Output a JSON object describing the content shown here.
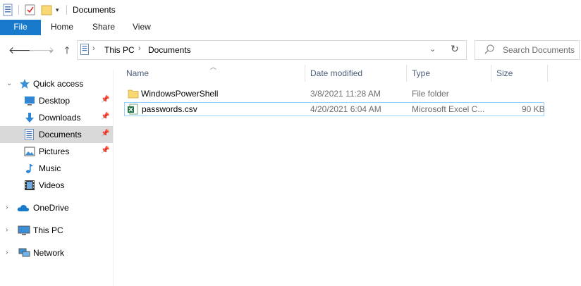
{
  "window": {
    "title": "Documents"
  },
  "ribbon": {
    "tabs": [
      {
        "label": "File"
      },
      {
        "label": "Home"
      },
      {
        "label": "Share"
      },
      {
        "label": "View"
      }
    ]
  },
  "address": {
    "crumbs": [
      {
        "label": "This PC"
      },
      {
        "label": "Documents"
      }
    ]
  },
  "search": {
    "placeholder": "Search Documents"
  },
  "nav": {
    "items": [
      {
        "label": "Quick access",
        "icon": "star-icon"
      },
      {
        "label": "Desktop",
        "icon": "desktop-icon",
        "pinned": true
      },
      {
        "label": "Downloads",
        "icon": "download-icon",
        "pinned": true
      },
      {
        "label": "Documents",
        "icon": "documents-icon",
        "pinned": true,
        "selected": true
      },
      {
        "label": "Pictures",
        "icon": "pictures-icon",
        "pinned": true
      },
      {
        "label": "Music",
        "icon": "music-icon"
      },
      {
        "label": "Videos",
        "icon": "videos-icon"
      },
      {
        "label": "OneDrive",
        "icon": "cloud-icon"
      },
      {
        "label": "This PC",
        "icon": "computer-icon"
      },
      {
        "label": "Network",
        "icon": "network-icon"
      }
    ]
  },
  "columns": {
    "name": "Name",
    "date": "Date modified",
    "type": "Type",
    "size": "Size"
  },
  "files": [
    {
      "name": "WindowsPowerShell",
      "date": "3/8/2021 11:28 AM",
      "type": "File folder",
      "size": "",
      "icon": "folder-icon"
    },
    {
      "name": "passwords.csv",
      "date": "4/20/2021 6:04 AM",
      "type": "Microsoft Excel C...",
      "size": "90 KB",
      "icon": "excel-icon",
      "selected": true
    }
  ],
  "colors": {
    "accent": "#1979ca",
    "selection_border": "#99d1ff",
    "nav_selected": "#d9d9d9",
    "header_text": "#4c607a"
  }
}
